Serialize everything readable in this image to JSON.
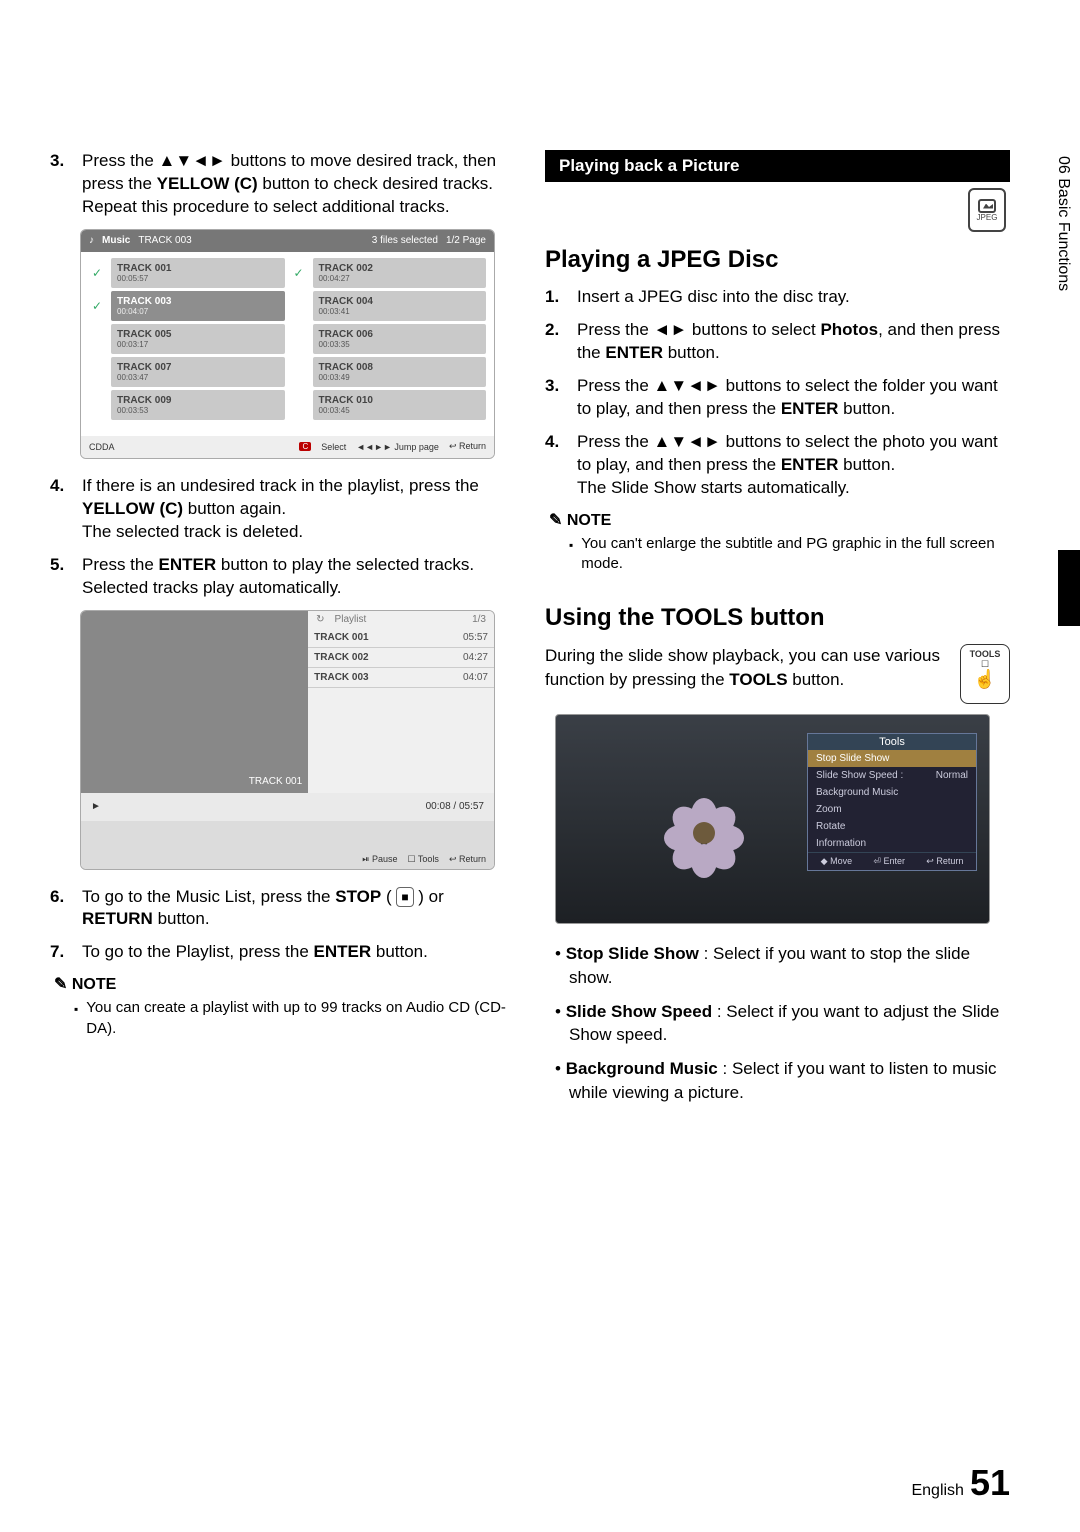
{
  "side_tab": "06   Basic Functions",
  "footer": {
    "lang": "English",
    "page": "51"
  },
  "left": {
    "step3": {
      "num": "3.",
      "t1": "Press the ",
      "arrows": "▲▼◄►",
      "t2": " buttons to move desired track, then press the ",
      "yellow": "YELLOW (C)",
      "t3": " button to check desired tracks.",
      "t4": "Repeat this procedure to select additional tracks."
    },
    "ss1": {
      "music": "Music",
      "cur": "TRACK 003",
      "sel": "3 files selected",
      "pg": "1/2 Page",
      "colL_chk": [
        "✓",
        "✓",
        "",
        "",
        ""
      ],
      "colL": [
        {
          "t": "TRACK 001",
          "d": "00:05:57"
        },
        {
          "t": "TRACK 003",
          "d": "00:04:07"
        },
        {
          "t": "TRACK 005",
          "d": "00:03:17"
        },
        {
          "t": "TRACK 007",
          "d": "00:03:47"
        },
        {
          "t": "TRACK 009",
          "d": "00:03:53"
        }
      ],
      "colR_chk": [
        "✓",
        "",
        "",
        "",
        ""
      ],
      "colR": [
        {
          "t": "TRACK 002",
          "d": "00:04:27"
        },
        {
          "t": "TRACK 004",
          "d": "00:03:41"
        },
        {
          "t": "TRACK 006",
          "d": "00:03:35"
        },
        {
          "t": "TRACK 008",
          "d": "00:03:49"
        },
        {
          "t": "TRACK 010",
          "d": "00:03:45"
        }
      ],
      "foot_l": "CDDA",
      "foot_c": "C",
      "foot_s": "Select",
      "foot_j": "◄◄►► Jump page",
      "foot_r": "↩ Return"
    },
    "step4": {
      "num": "4.",
      "t1": "If there is an undesired track in the playlist, press the ",
      "yellow": "YELLOW (C)",
      "t2": " button again.",
      "t3": "The selected track is deleted."
    },
    "step5": {
      "num": "5.",
      "t1": "Press the ",
      "enter": "ENTER",
      "t2": " button to play the selected tracks.",
      "t3": "Selected tracks play automatically."
    },
    "ss2": {
      "np": "TRACK 001",
      "pl": "Playlist",
      "pg": "1/3",
      "rows": [
        {
          "n": "TRACK 001",
          "d": "05:57"
        },
        {
          "n": "TRACK 002",
          "d": "04:27"
        },
        {
          "n": "TRACK 003",
          "d": "04:07"
        }
      ],
      "time": "00:08 / 05:57",
      "play": "►",
      "foot_pause": "⏯ Pause",
      "foot_tools": "☐ Tools",
      "foot_ret": "↩ Return"
    },
    "step6": {
      "num": "6.",
      "t1": "To go to the Music List, press the ",
      "stop": "STOP",
      "t2": " ( ",
      "t3": " ) or ",
      "ret": "RETURN",
      "t4": " button."
    },
    "step7": {
      "num": "7.",
      "t1": "To go to the Playlist, press the ",
      "enter": "ENTER",
      "t2": " button."
    },
    "note_h": "NOTE",
    "note1": "You can create a playlist with up to 99 tracks on Audio CD (CD-DA)."
  },
  "right": {
    "banner": "Playing back a Picture",
    "jpeg_label": "JPEG",
    "h_jpeg": "Playing a JPEG Disc",
    "j1": {
      "num": "1.",
      "t": "Insert a JPEG disc into the disc tray."
    },
    "j2": {
      "num": "2.",
      "t1": "Press the ",
      "arr": "◄►",
      "t2": " buttons to select ",
      "ph": "Photos",
      "t3": ", and then press the ",
      "en": "ENTER",
      "t4": " button."
    },
    "j3": {
      "num": "3.",
      "t1": "Press the ",
      "arr": "▲▼◄►",
      "t2": " buttons to select the folder you want to play, and then press the ",
      "en": "ENTER",
      "t3": " button."
    },
    "j4": {
      "num": "4.",
      "t1": "Press the ",
      "arr": "▲▼◄►",
      "t2": " buttons to select the photo you want to play, and then press the ",
      "en": "ENTER",
      "t3": " button.",
      "t4": "The Slide Show starts automatically."
    },
    "note_h": "NOTE",
    "note1": "You can't enlarge the subtitle and PG graphic in the full screen mode.",
    "h_tools": "Using the TOOLS button",
    "tools_btn_label": "TOOLS",
    "tools_p1": "During the slide show playback, you can use various function by pressing the ",
    "tools_b": "TOOLS",
    "tools_p2": " button.",
    "ss3": {
      "title": "Tools",
      "rows": [
        {
          "l": "Stop Slide Show",
          "r": ""
        },
        {
          "l": "Slide Show Speed :",
          "r": "Normal"
        },
        {
          "l": "Background Music",
          "r": ""
        },
        {
          "l": "Zoom",
          "r": ""
        },
        {
          "l": "Rotate",
          "r": ""
        },
        {
          "l": "Information",
          "r": ""
        }
      ],
      "foot_m": "◆ Move",
      "foot_e": "⏎ Enter",
      "foot_r": "↩ Return"
    },
    "bullets": [
      {
        "b": "Stop Slide Show",
        "t": " : Select if you want to stop the slide show."
      },
      {
        "b": "Slide Show Speed",
        "t": " : Select if you want to adjust the Slide Show speed."
      },
      {
        "b": "Background Music",
        "t": " : Select if you want to listen to music while viewing a picture."
      }
    ]
  }
}
